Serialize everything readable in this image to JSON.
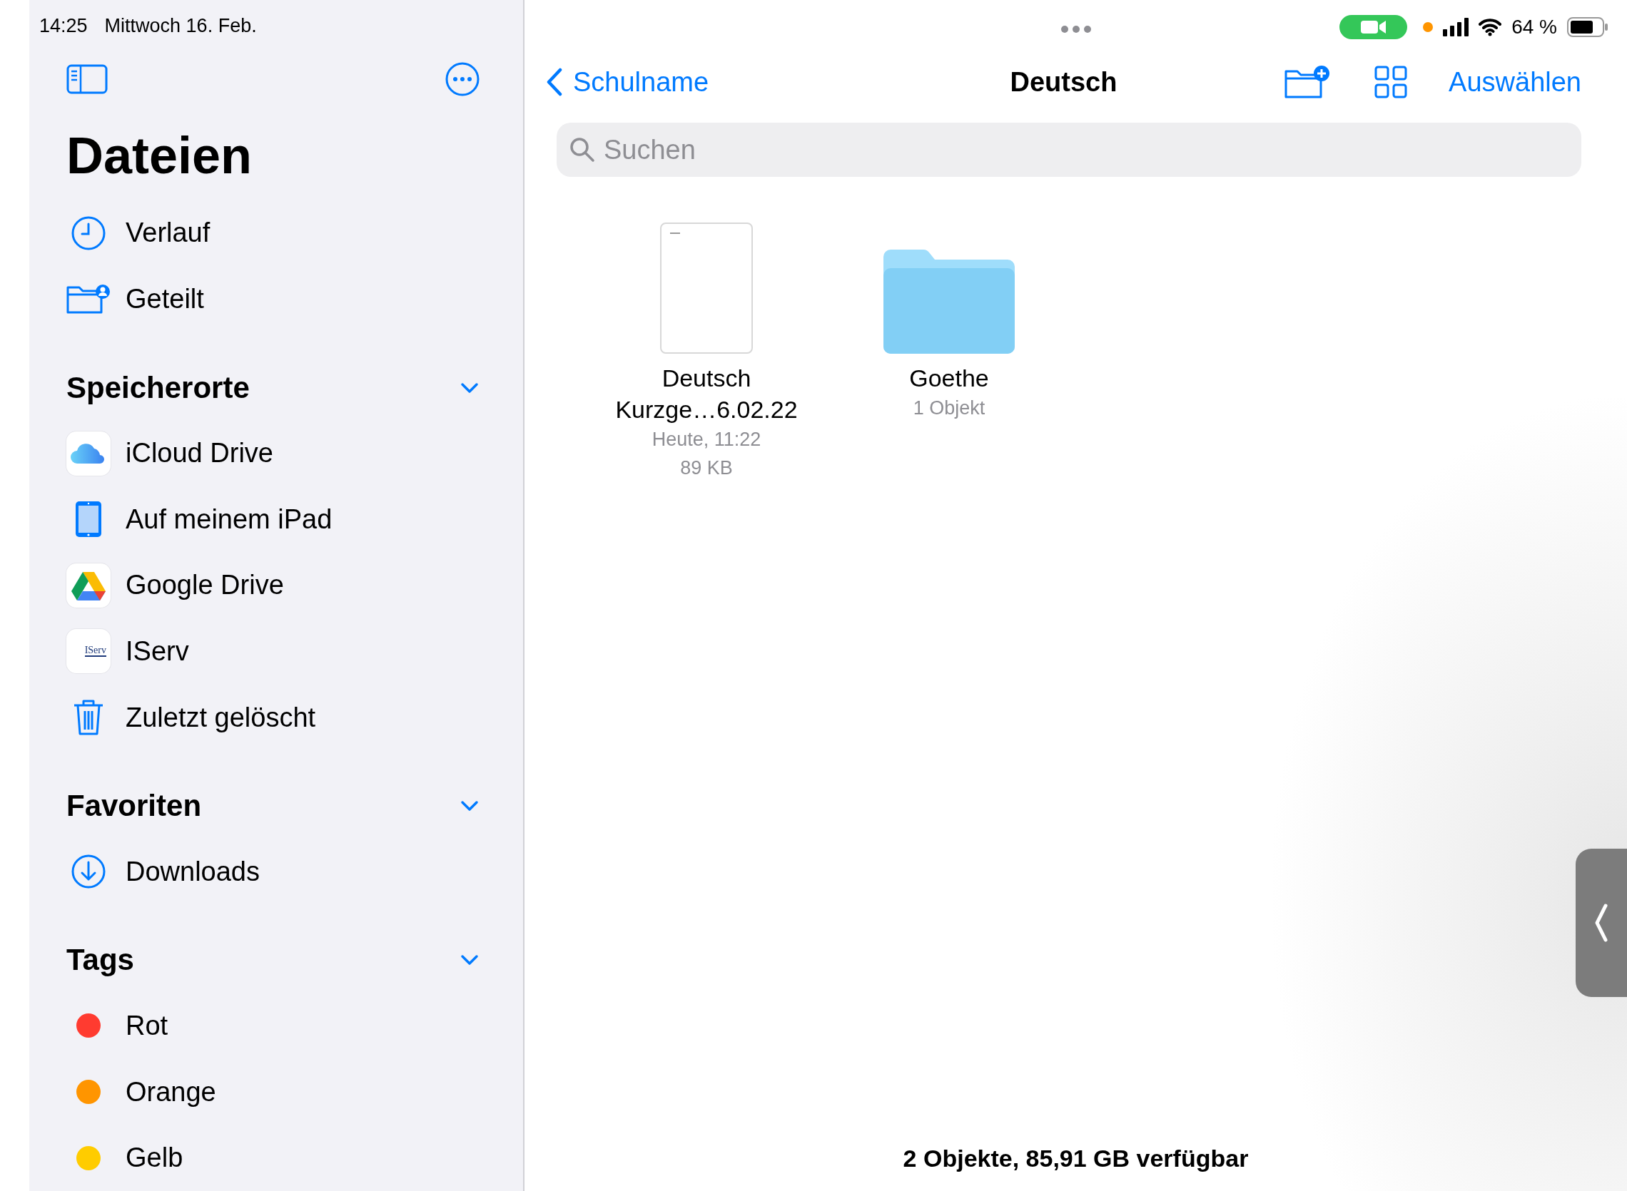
{
  "status_bar": {
    "time": "14:25",
    "date": "Mittwoch 16. Feb.",
    "battery": "64 %"
  },
  "sidebar": {
    "title": "Dateien",
    "top_items": [
      {
        "label": "Verlauf",
        "kind": "clock"
      },
      {
        "label": "Geteilt",
        "kind": "shared"
      }
    ],
    "sections": [
      {
        "title": "Speicherorte",
        "expanded": true,
        "items": [
          {
            "label": "iCloud Drive",
            "kind": "icloud"
          },
          {
            "label": "Auf meinem iPad",
            "kind": "ipad"
          },
          {
            "label": "Google Drive",
            "kind": "gdrive"
          },
          {
            "label": "IServ",
            "kind": "iserv",
            "icon_text": "IServ"
          },
          {
            "label": "Zuletzt gelöscht",
            "kind": "trash"
          }
        ]
      },
      {
        "title": "Favoriten",
        "expanded": true,
        "items": [
          {
            "label": "Downloads",
            "kind": "download"
          }
        ]
      },
      {
        "title": "Tags",
        "expanded": true,
        "items": [
          {
            "label": "Rot",
            "kind": "tag",
            "color": "#ff3b30"
          },
          {
            "label": "Orange",
            "kind": "tag",
            "color": "#ff9500"
          },
          {
            "label": "Gelb",
            "kind": "tag",
            "color": "#ffcc00"
          }
        ]
      }
    ]
  },
  "navigation": {
    "back": "Schulname",
    "title": "Deutsch",
    "action": "Auswählen"
  },
  "search": {
    "placeholder": "Suchen"
  },
  "files": [
    {
      "kind": "document",
      "name": "Deutsch Kurzge…6.02.22",
      "details": [
        "Heute, 11:22",
        "89 KB"
      ]
    },
    {
      "kind": "folder",
      "name": "Goethe",
      "details": [
        "1 Objekt"
      ]
    }
  ],
  "footer": "2 Objekte, 85,91 GB verfügbar"
}
